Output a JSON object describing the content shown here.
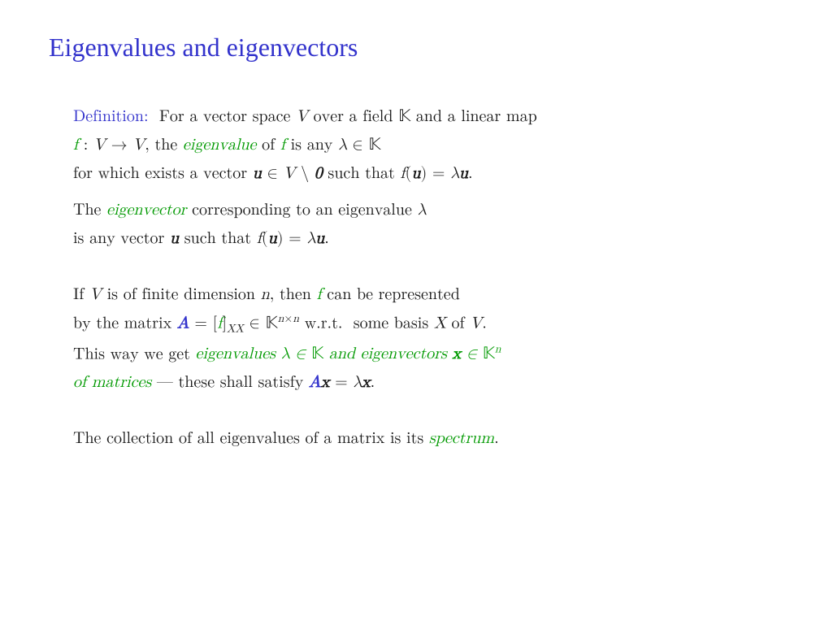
{
  "title": "Eigenvalues and eigenvectors",
  "colors": {
    "blue": "#3333cc",
    "green": "#009900",
    "black": "#1a1a1a"
  },
  "definition": {
    "label": "Definition:",
    "line1": "For a vector space V over a field 𝕂 and a linear map",
    "line2": "f : V → V, the eigenvalue of f is any λ ∈ 𝕂",
    "line3": "for which exists a vector u ∈ V \\ 0 such that f(u) = λu.",
    "line4": "The eigenvector corresponding to an eigenvalue λ",
    "line5": "is any vector u such that f(u) = λu."
  },
  "finite_dim": {
    "line1": "If V is of finite dimension n, then f can be represented",
    "line2": "by the matrix A = [f]_XX ∈ 𝕂^{n×n} w.r.t. some basis X of V.",
    "line3_green": "eigenvalues λ ∈ 𝕂 and eigenvectors x ∈ 𝕂ⁿ",
    "line3_pre": "This way we get",
    "line4_green": "of matrices",
    "line4_post": "— these shall satisfy Ax = λx."
  },
  "spectrum": {
    "text_pre": "The collection of all eigenvalues of a matrix is its",
    "text_green": "spectrum",
    "text_post": "."
  }
}
